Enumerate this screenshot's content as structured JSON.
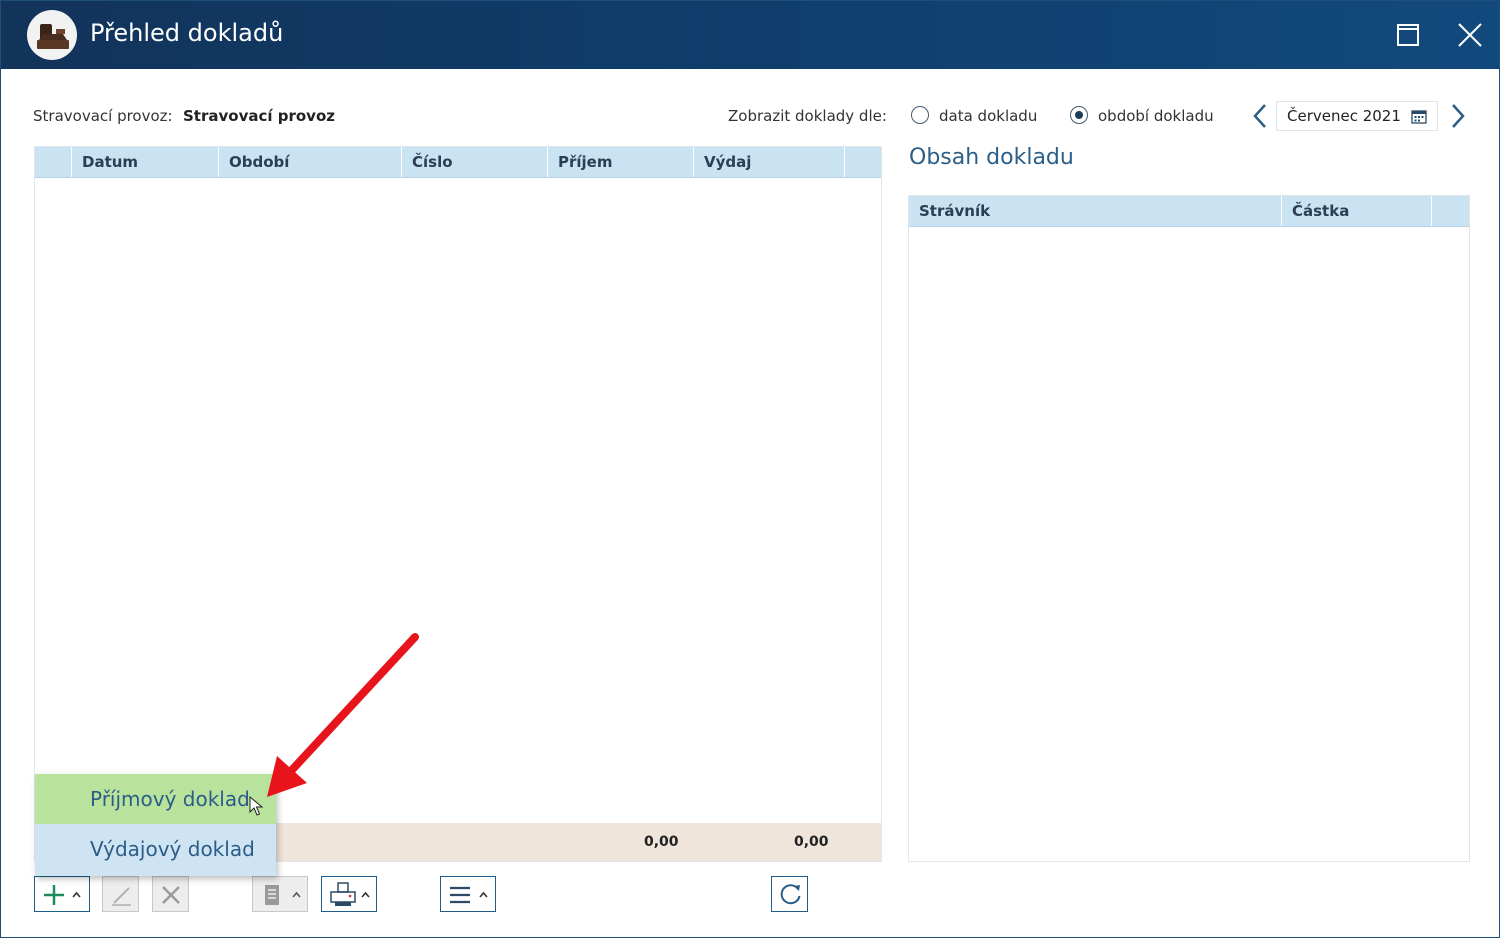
{
  "window": {
    "title": "Přehled dokladů",
    "app_icon": "cash-register-icon",
    "maximize_icon": "maximize-icon",
    "close_icon": "close-icon"
  },
  "filter": {
    "provoz_label": "Stravovací provoz:",
    "provoz_value": "Stravovací provoz",
    "show_by_label": "Zobrazit doklady dle:",
    "options": [
      {
        "label": "data dokladu",
        "selected": false
      },
      {
        "label": "období dokladu",
        "selected": true
      }
    ],
    "period": "Červenec 2021"
  },
  "doc_table": {
    "columns": [
      "Datum",
      "Období",
      "Číslo",
      "Příjem",
      "Výdaj"
    ],
    "rows": [],
    "totals": {
      "prijem": "0,00",
      "vydaj": "0,00"
    }
  },
  "detail": {
    "title": "Obsah dokladu",
    "columns": [
      "Strávník",
      "Částka"
    ],
    "rows": []
  },
  "add_menu": {
    "items": [
      "Příjmový doklad",
      "Výdajový doklad"
    ],
    "hovered_index": 0
  },
  "toolbar": {
    "buttons": [
      "add-icon",
      "edit-icon",
      "delete-icon",
      "document-icon",
      "print-icon",
      "menu-icon",
      "refresh-icon"
    ]
  },
  "colors": {
    "titlebar": "#12335a",
    "header": "#c9e3f3",
    "footer": "#efe5da",
    "menu_hover": "#b9e39c",
    "menu_bg": "#cfe4f3",
    "annotation_arrow": "#e8141b"
  }
}
